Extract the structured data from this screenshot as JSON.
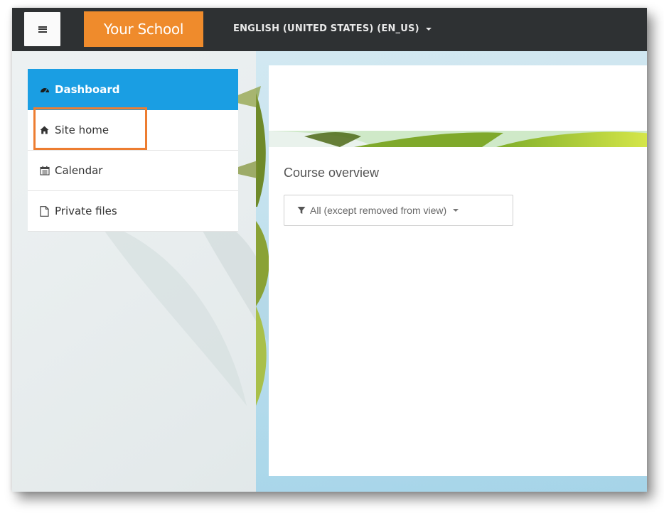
{
  "header": {
    "menu_icon": "hamburger-icon",
    "brand": "Your School",
    "language": "ENGLISH (UNITED STATES) (EN_US)"
  },
  "sidebar": {
    "items": [
      {
        "label": "Dashboard",
        "icon": "dashboard-icon",
        "active": true
      },
      {
        "label": "Site home",
        "icon": "home-icon",
        "highlighted": true
      },
      {
        "label": "Calendar",
        "icon": "calendar-icon"
      },
      {
        "label": "Private files",
        "icon": "file-icon"
      }
    ]
  },
  "main": {
    "section_title": "Course overview",
    "filter": {
      "icon": "filter-icon",
      "value": "All (except removed from view)"
    }
  },
  "colors": {
    "navbar": "#2e3133",
    "brand": "#ef8b2c",
    "active": "#1a9ee3",
    "highlight": "#ed7d31"
  }
}
